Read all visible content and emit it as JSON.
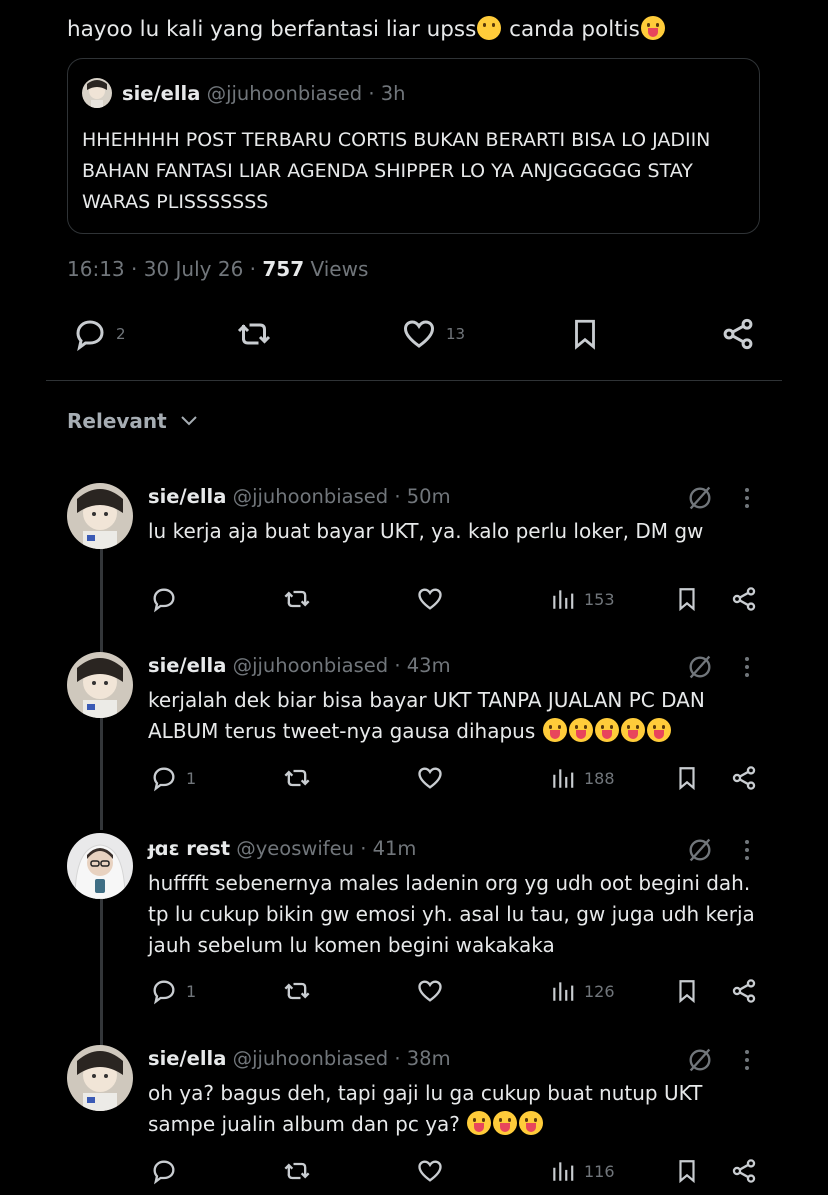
{
  "post": {
    "text": "hayoo lu kali yang berfantasi liar upss",
    "text_tail": " canda poltis",
    "emoji1": "hand-over-mouth-emoji",
    "emoji2": "winking-tongue-emoji"
  },
  "quote": {
    "name": "sie/ella",
    "handle": "@jjuhoonbiased",
    "time": "· 3h",
    "text": "HHEHHHH POST TERBARU CORTIS BUKAN BERARTI BISA LO JADIIN BAHAN FANTASI LIAR AGENDA SHIPPER LO YA ANJGGGGGG STAY WARAS PLISSSSSSS"
  },
  "meta": {
    "time": "16:13",
    "date": "30 July 26",
    "views_count": "757",
    "views_label": "Views"
  },
  "actions": {
    "replies": "2",
    "reposts": "",
    "likes": "13"
  },
  "sort": {
    "label": "Relevant"
  },
  "replies": [
    {
      "name": "sie/ella",
      "handle": "@jjuhoonbiased",
      "time": "· 50m",
      "text": "lu kerja aja buat bayar UKT, ya. kalo perlu loker, DM gw",
      "emojis": 0,
      "reply_count": "",
      "views": "153"
    },
    {
      "name": "sie/ella",
      "handle": "@jjuhoonbiased",
      "time": "· 43m",
      "text": "kerjalah dek biar bisa bayar UKT TANPA JUALAN PC DAN ALBUM terus tweet-nya gausa dihapus",
      "emojis": 5,
      "reply_count": "1",
      "views": "188"
    },
    {
      "name": "ɟɑɛ rest",
      "handle": "@yeoswifeu",
      "time": "· 41m",
      "text": "hufffft sebenernya males ladenin org yg udh oot begini dah. tp lu cukup bikin gw emosi yh. asal lu tau, gw juga udh kerja jauh sebelum lu komen begini wakakaka",
      "emojis": 0,
      "reply_count": "1",
      "views": "126"
    },
    {
      "name": "sie/ella",
      "handle": "@jjuhoonbiased",
      "time": "· 38m",
      "text": "oh ya? bagus deh, tapi gaji lu ga cukup buat nutup UKT sampe jualin album dan pc ya?",
      "emojis": 3,
      "reply_count": "",
      "views": "116"
    }
  ],
  "colors": {
    "background": "#000000",
    "text": "#e7e9ea",
    "muted": "#71767b",
    "border": "#2f3336",
    "emoji": "#ffcc3a"
  }
}
